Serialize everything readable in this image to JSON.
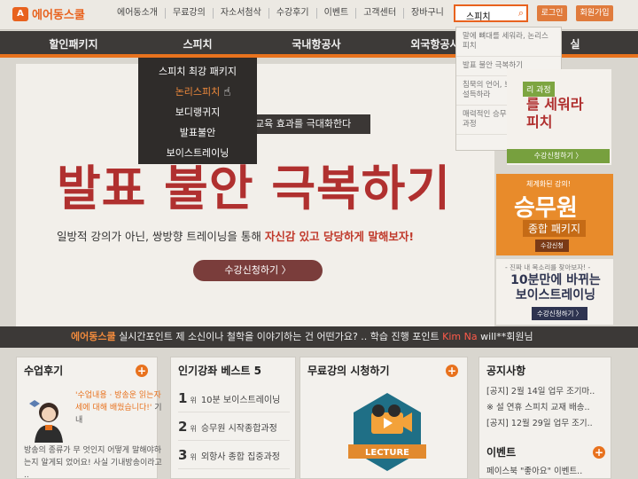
{
  "logo": {
    "mark": "A",
    "text": "에어동스쿨"
  },
  "topnav": [
    "에어동소개",
    "무료강의",
    "자소서첨삭",
    "수강후기",
    "이벤트",
    "고객센터",
    "장바구니"
  ],
  "search": {
    "value": "스피치"
  },
  "auth": {
    "login": "로그인",
    "join": "회원가입"
  },
  "mainnav": [
    "할인패키지",
    "스피치",
    "국내항공사",
    "외국항공사",
    "실"
  ],
  "dropdown": [
    "스피치 최강 패키지",
    "논리스피치",
    "보디랭귀지",
    "발표불안",
    "보이스트레이닝"
  ],
  "suggestions": [
    "말에 뼈대를 세워라, 논리스피치",
    "발표 불안 극복하기",
    "침묵의 언어, 보디랭귀지로 설득하라",
    "매력적인 승무원 발음,발성 과정"
  ],
  "hero": {
    "strip": "교육 효과를 극대화한다",
    "title": "발표 불안 극복하기",
    "sub_pre": "일방적 강의가 아닌, 쌍방향 트레이닝을 통해 ",
    "sub_hl": "자신감 있고 당당하게 말해보자!",
    "button": "수강신청하기 〉"
  },
  "promo1": {
    "tag": "리 과정",
    "line1": "를 세워라",
    "line2": "피치",
    "button": "수강신청하기 〉"
  },
  "promo2": {
    "small": "체계화된 강의!",
    "big": "승무원",
    "pkg": "종합 패키지",
    "button": "수강신청"
  },
  "promo3": {
    "small": "- 진짜 내 목소리를 찾아보자! -",
    "line1": "10분만에 바뀌는",
    "line2": "보이스트레이닝",
    "button": "수강신청하기 〉"
  },
  "ticker": {
    "brand": "에어동스쿨",
    "text": " 실시간포인트 제 소신이나 철학을 이야기하는 건 어떤가요? .. 학습 진행 포인트 ",
    "user": "Kim Na",
    "tail": " will**회원님"
  },
  "review": {
    "title": "수업후기",
    "quote_hl": "'수업내용 · 방송운 읽는자세에 대해 배웠습니다!'",
    "quote_tail": " 기내",
    "body": "방송의 종류가 무 엇인지 어떻게 말해야하는지 알게되 었어요! 사실 기내방송이라고 .."
  },
  "best": {
    "title": "인기강좌 베스트 5",
    "items": [
      {
        "num": "1",
        "unit": "위",
        "label": "10분 보이스트레이닝"
      },
      {
        "num": "2",
        "unit": "위",
        "label": "승무원 시작종합과정"
      },
      {
        "num": "3",
        "unit": "위",
        "label": "외항사 종합 집중과정"
      }
    ]
  },
  "free": {
    "title": "무료강의 시청하기",
    "badge": "LECTURE"
  },
  "notice": {
    "title": "공지사항",
    "items": [
      "[공지] 2월 14일 업무 조기마..",
      "※ 설 연휴 스피치 교재 배송..",
      "[공지] 12월 29일 업무 조기.."
    ],
    "event_title": "이벤트",
    "event_item": "페이스북 \"좋아요\" 이벤트.."
  }
}
